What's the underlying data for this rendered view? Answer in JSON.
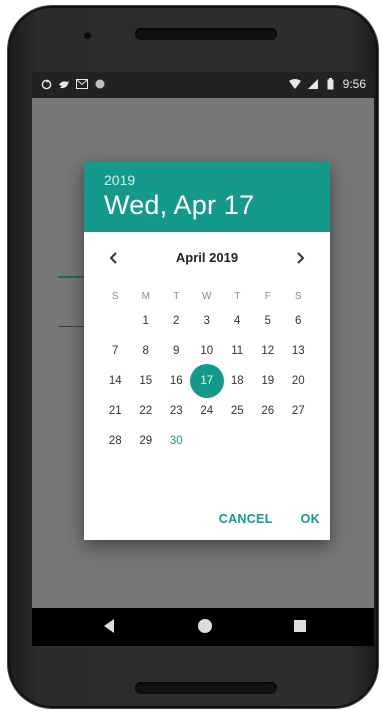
{
  "statusbar": {
    "time": "9:56",
    "left_icons": [
      "sync-icon",
      "bird-icon",
      "mail-icon",
      "circle-icon"
    ],
    "right_icons": [
      "wifi-icon",
      "signal-icon",
      "battery-icon"
    ]
  },
  "dialog": {
    "year": "2019",
    "date": "Wed, Apr 17",
    "month_title": "April 2019",
    "weekdays": [
      "S",
      "M",
      "T",
      "W",
      "T",
      "F",
      "S"
    ],
    "weeks": [
      [
        "",
        "1",
        "2",
        "3",
        "4",
        "5",
        "6"
      ],
      [
        "7",
        "8",
        "9",
        "10",
        "11",
        "12",
        "13"
      ],
      [
        "14",
        "15",
        "16",
        "17",
        "18",
        "19",
        "20"
      ],
      [
        "21",
        "22",
        "23",
        "24",
        "25",
        "26",
        "27"
      ],
      [
        "28",
        "29",
        "30",
        "",
        "",
        "",
        ""
      ]
    ],
    "selected_day": "17",
    "highlight_day": "30",
    "cancel_label": "CANCEL",
    "ok_label": "OK",
    "accent_color": "#139a8b"
  },
  "navbar": {
    "buttons": [
      "back-icon",
      "home-icon",
      "recents-icon"
    ]
  }
}
